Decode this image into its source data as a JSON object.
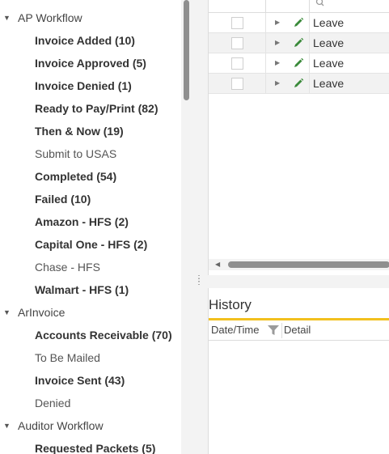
{
  "tree": {
    "groups": [
      {
        "label": "AP Workflow",
        "items": [
          {
            "label": "Invoice Added (10)",
            "bold": true
          },
          {
            "label": "Invoice Approved (5)",
            "bold": true
          },
          {
            "label": "Invoice Denied (1)",
            "bold": true
          },
          {
            "label": "Ready to Pay/Print (82)",
            "bold": true
          },
          {
            "label": "Then & Now (19)",
            "bold": true
          },
          {
            "label": "Submit to USAS",
            "bold": false
          },
          {
            "label": "Completed (54)",
            "bold": true
          },
          {
            "label": "Failed (10)",
            "bold": true
          },
          {
            "label": "Amazon - HFS (2)",
            "bold": true
          },
          {
            "label": "Capital One - HFS (2)",
            "bold": true
          },
          {
            "label": "Chase - HFS",
            "bold": false
          },
          {
            "label": "Walmart - HFS (1)",
            "bold": true
          }
        ]
      },
      {
        "label": "ArInvoice",
        "items": [
          {
            "label": "Accounts Receivable (70)",
            "bold": true
          },
          {
            "label": "To Be Mailed",
            "bold": false
          },
          {
            "label": "Invoice Sent (43)",
            "bold": true
          },
          {
            "label": "Denied",
            "bold": false
          }
        ]
      },
      {
        "label": "Auditor Workflow",
        "items": [
          {
            "label": "Requested Packets (5)",
            "bold": true
          }
        ]
      }
    ]
  },
  "grid": {
    "rows": [
      {
        "text": "Leave"
      },
      {
        "text": "Leave"
      },
      {
        "text": "Leave"
      },
      {
        "text": "Leave"
      }
    ]
  },
  "history": {
    "title": "History",
    "columns": {
      "date": "Date/Time",
      "detail": "Detail"
    }
  },
  "colors": {
    "accent": "#f2c01e",
    "edit_icon": "#3a8a3a"
  },
  "icons": {
    "group": "caret-down-icon",
    "row": "chevron-right-icon",
    "edit": "pencil-icon",
    "filter": "filter-icon"
  }
}
